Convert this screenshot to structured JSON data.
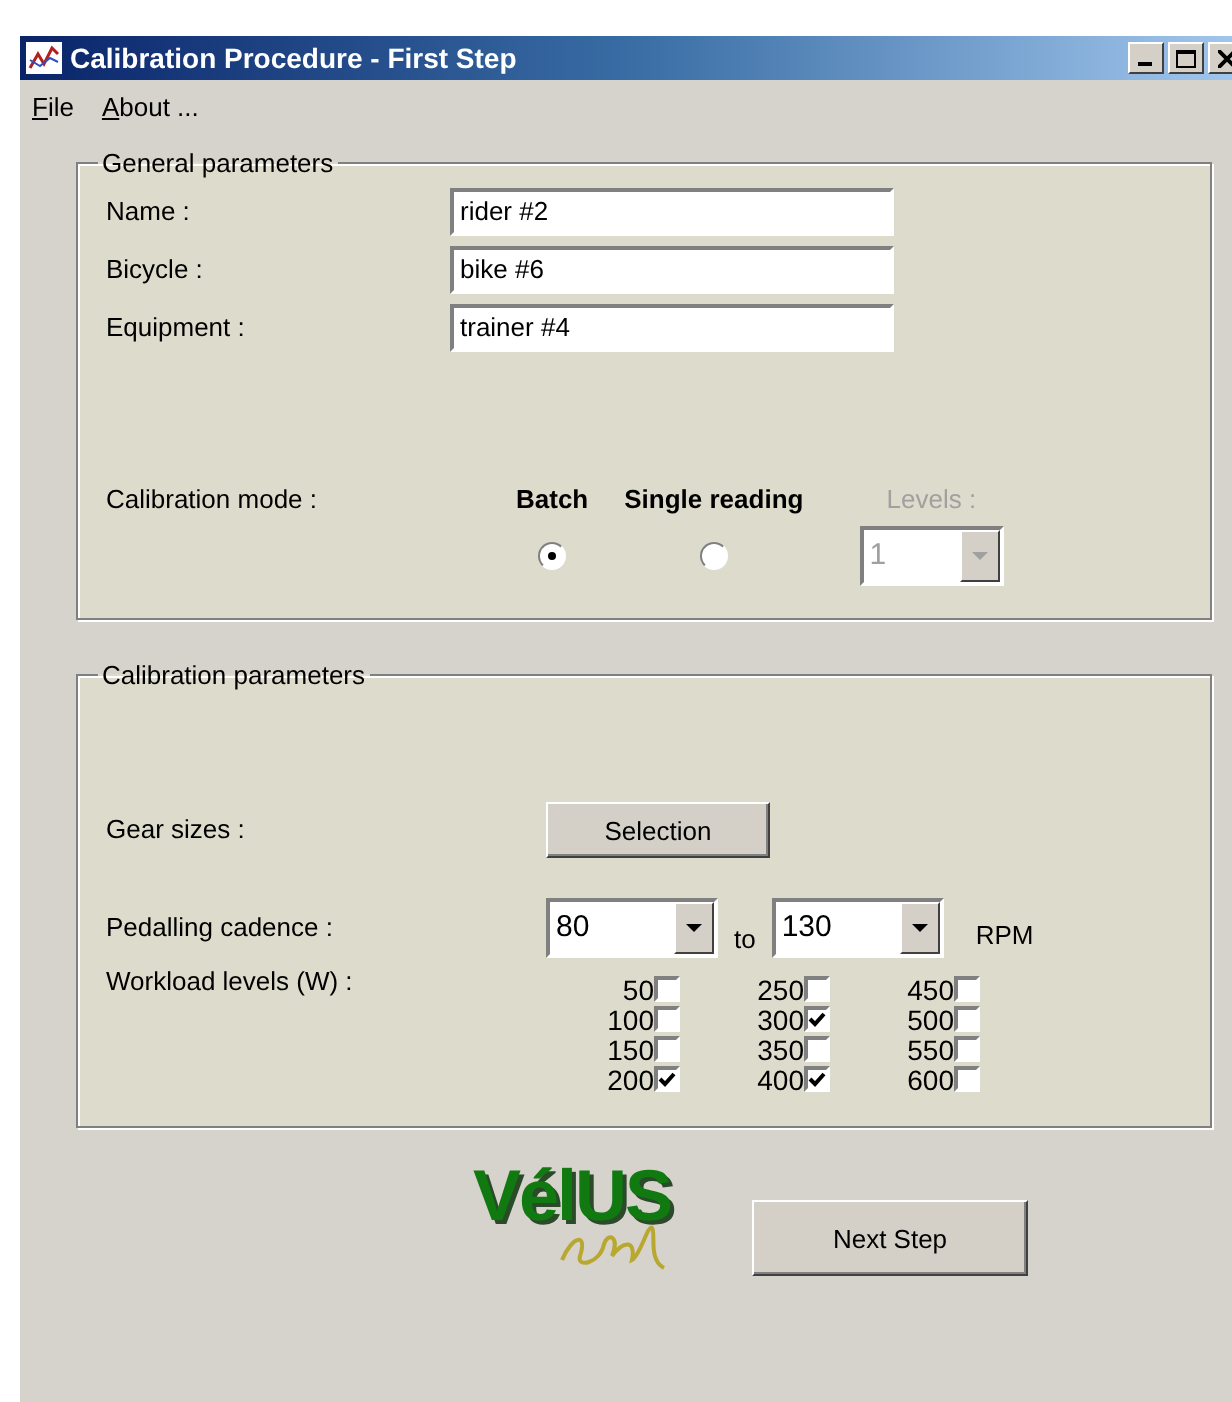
{
  "window": {
    "title": "Calibration Procedure - First Step"
  },
  "menu": [
    {
      "label": "File"
    },
    {
      "label": "About ..."
    }
  ],
  "general": {
    "legend": "General parameters",
    "fields": [
      {
        "label": "Name :",
        "value": "rider #2"
      },
      {
        "label": "Bicycle :",
        "value": "bike #6"
      },
      {
        "label": "Equipment :",
        "value": "trainer #4"
      }
    ],
    "mode_label": "Calibration mode :",
    "modes": [
      {
        "label": "Batch",
        "selected": true
      },
      {
        "label": "Single reading",
        "selected": false
      }
    ],
    "levels": {
      "label": "Levels :",
      "value": "1",
      "disabled": true
    }
  },
  "calibration": {
    "legend": "Calibration parameters",
    "gear_label": "Gear sizes :",
    "gear_button": "Selection",
    "cadence_label": "Pedalling cadence :",
    "cadence_from": "80",
    "cadence_to_word": "to",
    "cadence_to": "130",
    "cadence_unit": "RPM",
    "workload_label": "Workload levels (W) :",
    "workloads": [
      [
        {
          "label": "50",
          "checked": false
        },
        {
          "label": "100",
          "checked": false
        },
        {
          "label": "150",
          "checked": false
        },
        {
          "label": "200",
          "checked": true
        }
      ],
      [
        {
          "label": "250",
          "checked": false
        },
        {
          "label": "300",
          "checked": true
        },
        {
          "label": "350",
          "checked": false
        },
        {
          "label": "400",
          "checked": true
        }
      ],
      [
        {
          "label": "450",
          "checked": false
        },
        {
          "label": "500",
          "checked": false
        },
        {
          "label": "550",
          "checked": false
        },
        {
          "label": "600",
          "checked": false
        }
      ]
    ]
  },
  "logo": "VélUS",
  "next_button": "Next Step"
}
